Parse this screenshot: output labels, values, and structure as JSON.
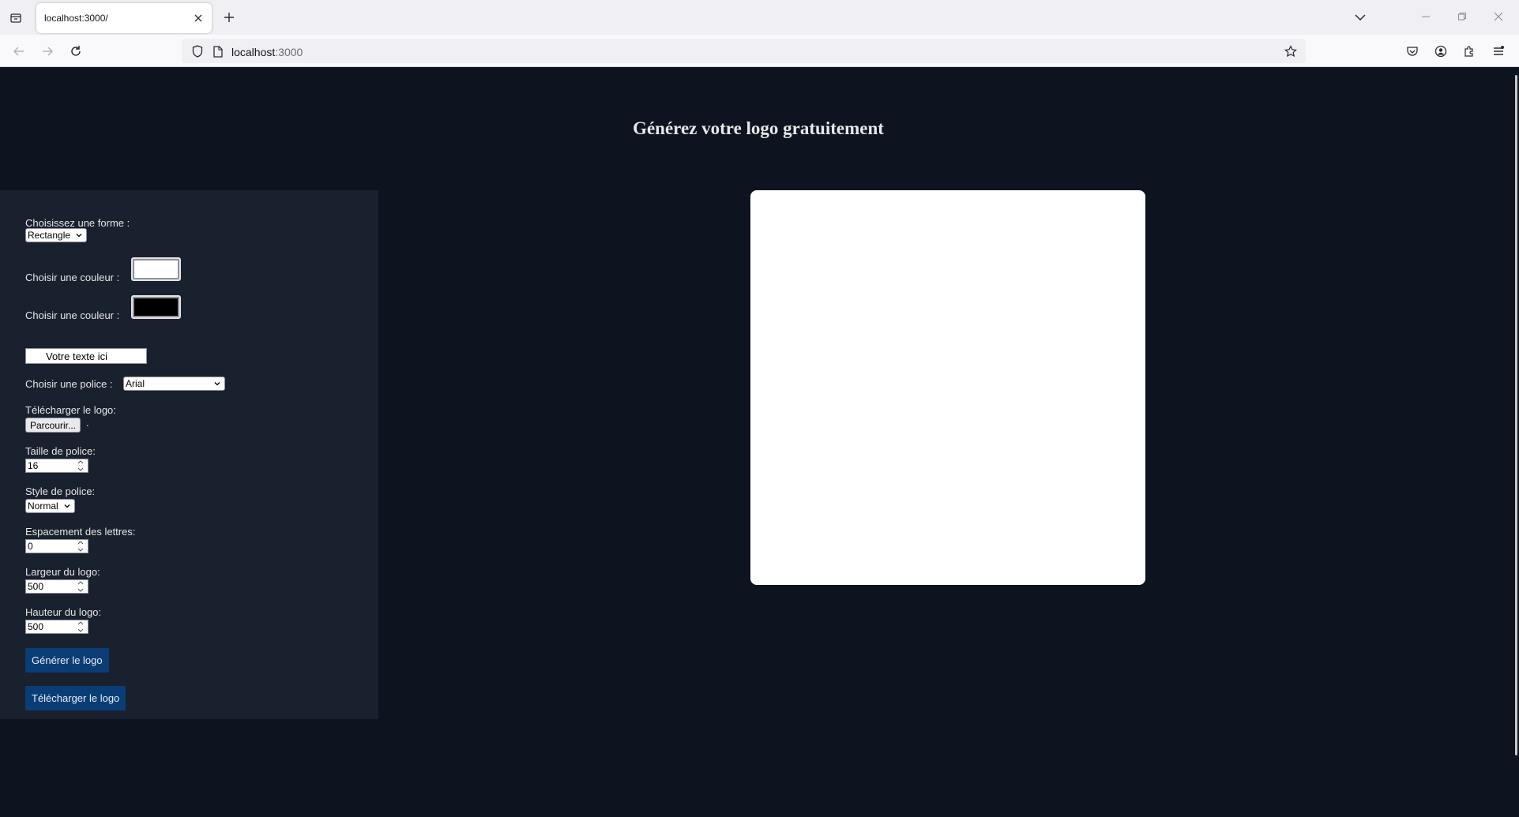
{
  "browser": {
    "tab_title": "localhost:3000/",
    "url_host": "localhost",
    "url_port": ":3000"
  },
  "page": {
    "title": "Générez votre logo gratuitement"
  },
  "form": {
    "shape_label": "Choisissez une forme :",
    "shape_value": "Rectangle",
    "color1_label": "Choisir une couleur :",
    "color1_value": "#ffffff",
    "color2_label": "Choisir une couleur :",
    "color2_value": "#000000",
    "text_value": "Votre texte ici",
    "font_label": "Choisir une police :",
    "font_value": "Arial",
    "upload_label": "Télécharger le logo:",
    "browse_button": "Parcourir...",
    "file_status": ".",
    "font_size_label": "Taille de police:",
    "font_size_value": "16",
    "font_style_label": "Style de police:",
    "font_style_value": "Normal",
    "letter_spacing_label": "Espacement des lettres:",
    "letter_spacing_value": "0",
    "width_label": "Largeur du logo:",
    "width_value": "500",
    "height_label": "Hauteur du logo:",
    "height_value": "500",
    "generate_button": "Générer le logo",
    "download_button": "Télécharger le logo"
  },
  "colors": {
    "page_bg": "#0d131f",
    "panel_bg": "#19212e",
    "button_bg": "#0a3d75"
  }
}
